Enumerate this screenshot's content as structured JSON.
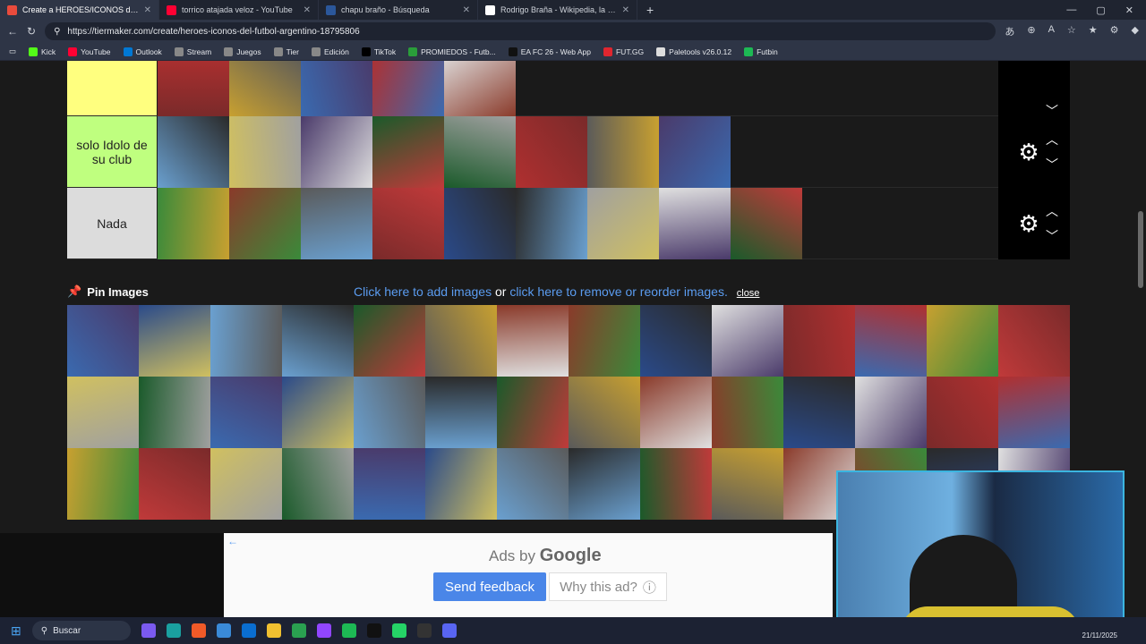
{
  "browser": {
    "tabs": [
      {
        "title": "Create a HEROES/ICONOS del FU",
        "color": "#e94b3c",
        "active": true
      },
      {
        "title": "torrico atajada veloz - YouTube",
        "color": "#ff0033",
        "active": false
      },
      {
        "title": "chapu braño - Búsqueda",
        "color": "#2b579a",
        "active": false
      },
      {
        "title": "Rodrigo Braña - Wikipedia, la enc",
        "color": "#ffffff",
        "active": false
      }
    ],
    "url": "https://tiermaker.com/create/heroes-iconos-del-futbol-argentino-18795806",
    "bookmarks": [
      {
        "label": "Kick",
        "color": "#53fc18"
      },
      {
        "label": "YouTube",
        "color": "#ff0033"
      },
      {
        "label": "Outlook",
        "color": "#0078d4"
      },
      {
        "label": "Stream",
        "color": "#888888"
      },
      {
        "label": "Juegos",
        "color": "#888888"
      },
      {
        "label": "Tier",
        "color": "#888888"
      },
      {
        "label": "Edición",
        "color": "#888888"
      },
      {
        "label": "TikTok",
        "color": "#000000"
      },
      {
        "label": "PROMIEDOS - Futb...",
        "color": "#2a9d3a"
      },
      {
        "label": "EA FC 26 - Web App",
        "color": "#111111"
      },
      {
        "label": "FUT.GG",
        "color": "#e0262f"
      },
      {
        "label": "Paletools v26.0.12",
        "color": "#dddddd"
      },
      {
        "label": "Futbin",
        "color": "#1db954"
      }
    ]
  },
  "tiers": [
    {
      "label": "",
      "color": "#ffff7f",
      "count": 5
    },
    {
      "label": "solo Idolo de su club",
      "color": "#bfff7f",
      "count": 8
    },
    {
      "label": "Nada",
      "color": "#dcdcdc",
      "count": 9
    }
  ],
  "pin": {
    "title": "Pin Images",
    "add_link": "Click here to add images",
    "or": " or ",
    "remove_link": "click here to remove or reorder images.",
    "close": "close"
  },
  "pool_count": 42,
  "ad": {
    "ads_by": "Ads by",
    "google": "Google",
    "feedback": "Send feedback",
    "why": "Why this ad?"
  },
  "taskbar": {
    "search": "Buscar",
    "date": "21/11/2025"
  }
}
